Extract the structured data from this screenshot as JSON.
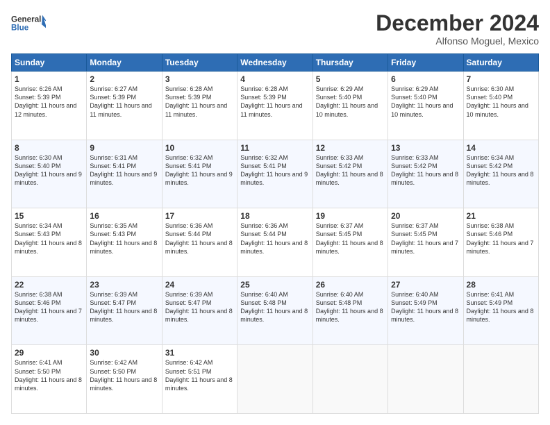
{
  "logo": {
    "line1": "General",
    "line2": "Blue"
  },
  "title": "December 2024",
  "subtitle": "Alfonso Moguel, Mexico",
  "days_of_week": [
    "Sunday",
    "Monday",
    "Tuesday",
    "Wednesday",
    "Thursday",
    "Friday",
    "Saturday"
  ],
  "weeks": [
    [
      {
        "day": "1",
        "sunrise": "6:26 AM",
        "sunset": "5:39 PM",
        "daylight": "11 hours and 12 minutes."
      },
      {
        "day": "2",
        "sunrise": "6:27 AM",
        "sunset": "5:39 PM",
        "daylight": "11 hours and 11 minutes."
      },
      {
        "day": "3",
        "sunrise": "6:28 AM",
        "sunset": "5:39 PM",
        "daylight": "11 hours and 11 minutes."
      },
      {
        "day": "4",
        "sunrise": "6:28 AM",
        "sunset": "5:39 PM",
        "daylight": "11 hours and 11 minutes."
      },
      {
        "day": "5",
        "sunrise": "6:29 AM",
        "sunset": "5:40 PM",
        "daylight": "11 hours and 10 minutes."
      },
      {
        "day": "6",
        "sunrise": "6:29 AM",
        "sunset": "5:40 PM",
        "daylight": "11 hours and 10 minutes."
      },
      {
        "day": "7",
        "sunrise": "6:30 AM",
        "sunset": "5:40 PM",
        "daylight": "11 hours and 10 minutes."
      }
    ],
    [
      {
        "day": "8",
        "sunrise": "6:30 AM",
        "sunset": "5:40 PM",
        "daylight": "11 hours and 9 minutes."
      },
      {
        "day": "9",
        "sunrise": "6:31 AM",
        "sunset": "5:41 PM",
        "daylight": "11 hours and 9 minutes."
      },
      {
        "day": "10",
        "sunrise": "6:32 AM",
        "sunset": "5:41 PM",
        "daylight": "11 hours and 9 minutes."
      },
      {
        "day": "11",
        "sunrise": "6:32 AM",
        "sunset": "5:41 PM",
        "daylight": "11 hours and 9 minutes."
      },
      {
        "day": "12",
        "sunrise": "6:33 AM",
        "sunset": "5:42 PM",
        "daylight": "11 hours and 8 minutes."
      },
      {
        "day": "13",
        "sunrise": "6:33 AM",
        "sunset": "5:42 PM",
        "daylight": "11 hours and 8 minutes."
      },
      {
        "day": "14",
        "sunrise": "6:34 AM",
        "sunset": "5:42 PM",
        "daylight": "11 hours and 8 minutes."
      }
    ],
    [
      {
        "day": "15",
        "sunrise": "6:34 AM",
        "sunset": "5:43 PM",
        "daylight": "11 hours and 8 minutes."
      },
      {
        "day": "16",
        "sunrise": "6:35 AM",
        "sunset": "5:43 PM",
        "daylight": "11 hours and 8 minutes."
      },
      {
        "day": "17",
        "sunrise": "6:36 AM",
        "sunset": "5:44 PM",
        "daylight": "11 hours and 8 minutes."
      },
      {
        "day": "18",
        "sunrise": "6:36 AM",
        "sunset": "5:44 PM",
        "daylight": "11 hours and 8 minutes."
      },
      {
        "day": "19",
        "sunrise": "6:37 AM",
        "sunset": "5:45 PM",
        "daylight": "11 hours and 8 minutes."
      },
      {
        "day": "20",
        "sunrise": "6:37 AM",
        "sunset": "5:45 PM",
        "daylight": "11 hours and 7 minutes."
      },
      {
        "day": "21",
        "sunrise": "6:38 AM",
        "sunset": "5:46 PM",
        "daylight": "11 hours and 7 minutes."
      }
    ],
    [
      {
        "day": "22",
        "sunrise": "6:38 AM",
        "sunset": "5:46 PM",
        "daylight": "11 hours and 7 minutes."
      },
      {
        "day": "23",
        "sunrise": "6:39 AM",
        "sunset": "5:47 PM",
        "daylight": "11 hours and 8 minutes."
      },
      {
        "day": "24",
        "sunrise": "6:39 AM",
        "sunset": "5:47 PM",
        "daylight": "11 hours and 8 minutes."
      },
      {
        "day": "25",
        "sunrise": "6:40 AM",
        "sunset": "5:48 PM",
        "daylight": "11 hours and 8 minutes."
      },
      {
        "day": "26",
        "sunrise": "6:40 AM",
        "sunset": "5:48 PM",
        "daylight": "11 hours and 8 minutes."
      },
      {
        "day": "27",
        "sunrise": "6:40 AM",
        "sunset": "5:49 PM",
        "daylight": "11 hours and 8 minutes."
      },
      {
        "day": "28",
        "sunrise": "6:41 AM",
        "sunset": "5:49 PM",
        "daylight": "11 hours and 8 minutes."
      }
    ],
    [
      {
        "day": "29",
        "sunrise": "6:41 AM",
        "sunset": "5:50 PM",
        "daylight": "11 hours and 8 minutes."
      },
      {
        "day": "30",
        "sunrise": "6:42 AM",
        "sunset": "5:50 PM",
        "daylight": "11 hours and 8 minutes."
      },
      {
        "day": "31",
        "sunrise": "6:42 AM",
        "sunset": "5:51 PM",
        "daylight": "11 hours and 8 minutes."
      },
      null,
      null,
      null,
      null
    ]
  ]
}
